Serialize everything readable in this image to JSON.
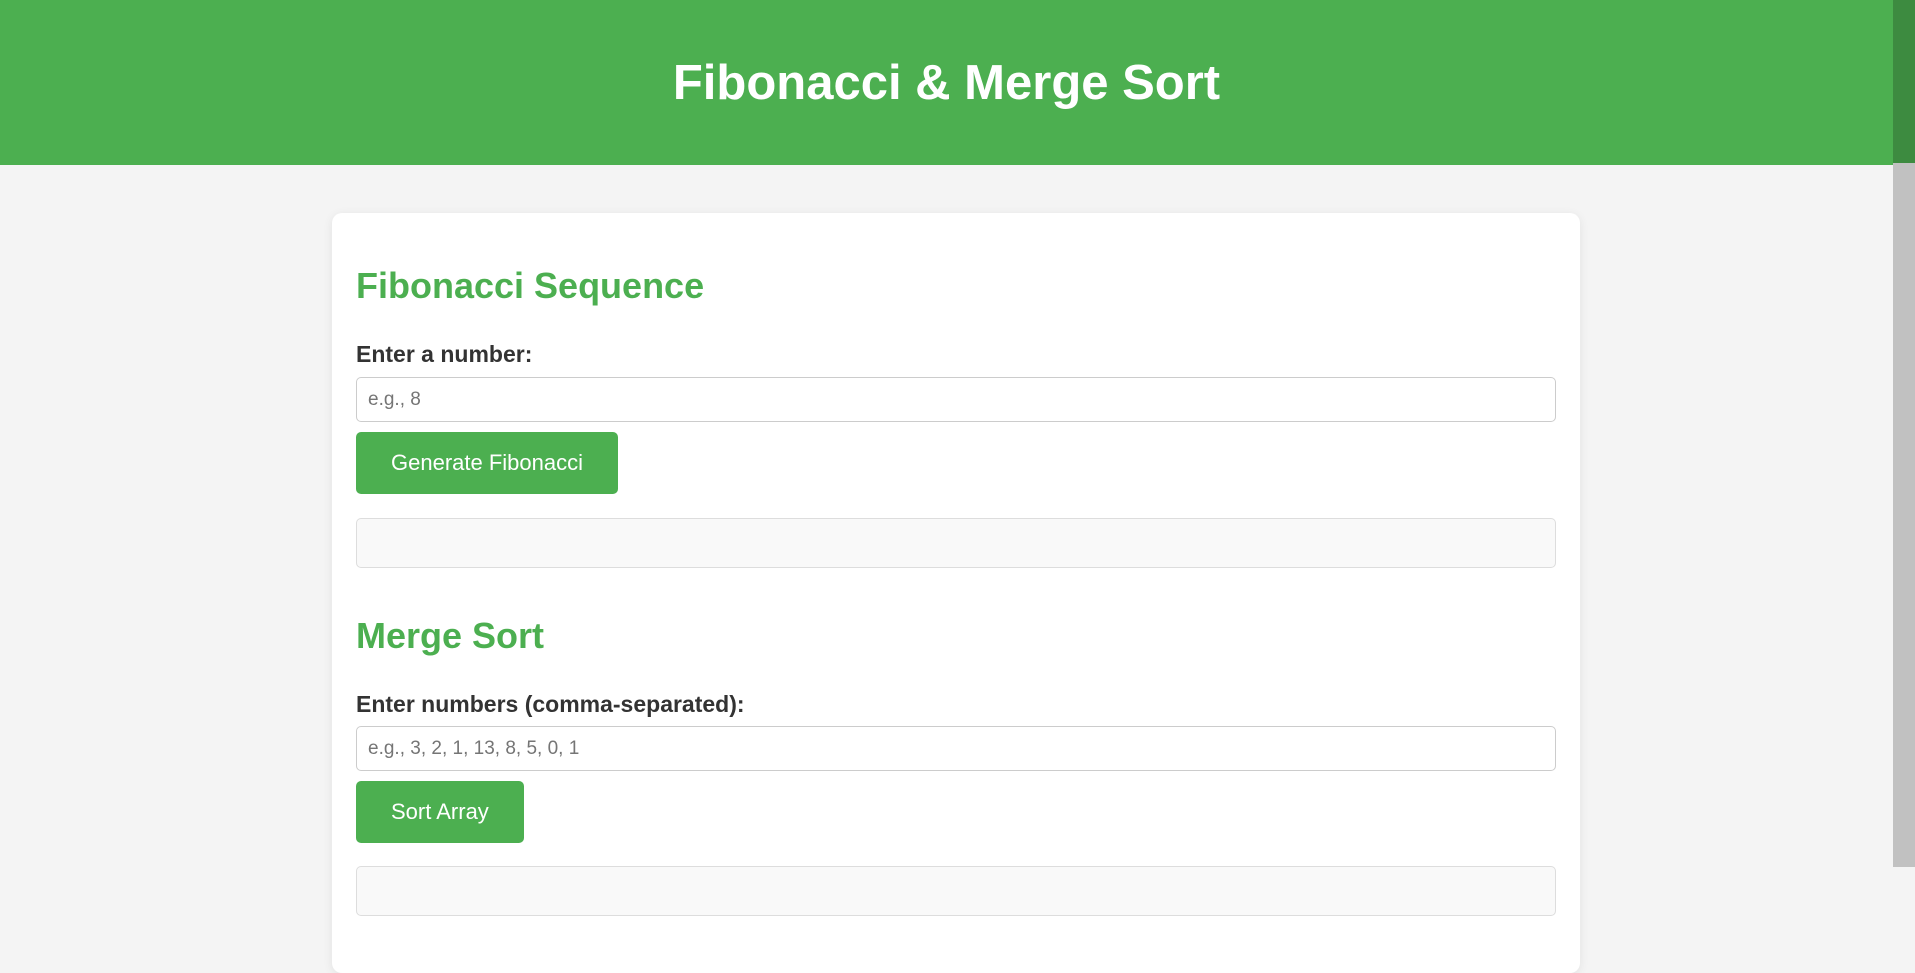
{
  "header": {
    "title": "Fibonacci & Merge Sort"
  },
  "fibonacci": {
    "title": "Fibonacci Sequence",
    "label": "Enter a number:",
    "input_value": "",
    "placeholder": "e.g., 8",
    "button_label": "Generate Fibonacci",
    "result": ""
  },
  "merge_sort": {
    "title": "Merge Sort",
    "label": "Enter numbers (comma-separated):",
    "input_value": "",
    "placeholder": "e.g., 3, 2, 1, 13, 8, 5, 0, 1",
    "button_label": "Sort Array",
    "result": ""
  },
  "colors": {
    "accent": "#4caf50",
    "background": "#f4f4f4",
    "card": "#ffffff"
  }
}
